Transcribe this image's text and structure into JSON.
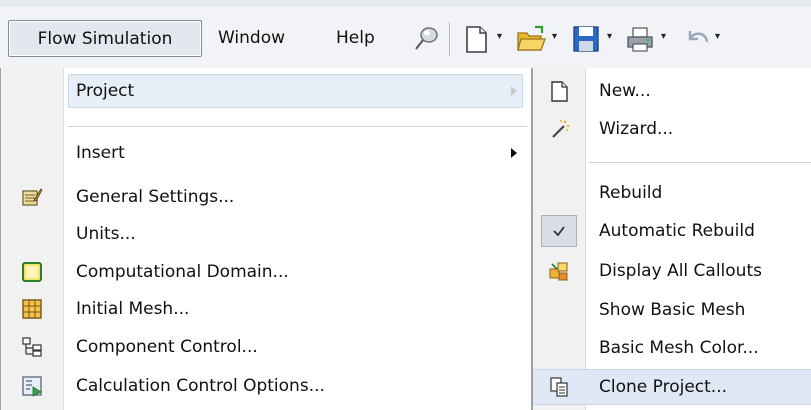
{
  "menubar": {
    "items": [
      {
        "label": "Flow Simulation",
        "active": true
      },
      {
        "label": "Window"
      },
      {
        "label": "Help"
      }
    ],
    "toolbar_icons": [
      "pin-icon",
      "new-document-icon",
      "open-folder-icon",
      "save-icon",
      "print-icon",
      "undo-icon"
    ]
  },
  "left_menu": {
    "items": [
      {
        "label": "Project",
        "submenu": true,
        "highlighted": true
      },
      {
        "label": "Insert",
        "submenu": true
      },
      {
        "label": "General Settings...",
        "icon": "general-settings-icon"
      },
      {
        "label": "Units..."
      },
      {
        "label": "Computational Domain...",
        "icon": "computational-domain-icon"
      },
      {
        "label": "Initial Mesh...",
        "icon": "initial-mesh-icon"
      },
      {
        "label": "Component Control...",
        "icon": "component-control-icon"
      },
      {
        "label": "Calculation Control Options...",
        "icon": "calculation-control-icon"
      }
    ]
  },
  "right_menu": {
    "items": [
      {
        "label": "New...",
        "icon": "new-project-icon"
      },
      {
        "label": "Wizard...",
        "icon": "wizard-icon"
      },
      {
        "label": "Rebuild"
      },
      {
        "label": "Automatic Rebuild",
        "checked": true
      },
      {
        "label": "Display All Callouts",
        "icon": "callouts-icon"
      },
      {
        "label": "Show Basic Mesh"
      },
      {
        "label": "Basic Mesh Color..."
      },
      {
        "label": "Clone Project...",
        "icon": "clone-project-icon",
        "highlighted": true
      }
    ]
  }
}
